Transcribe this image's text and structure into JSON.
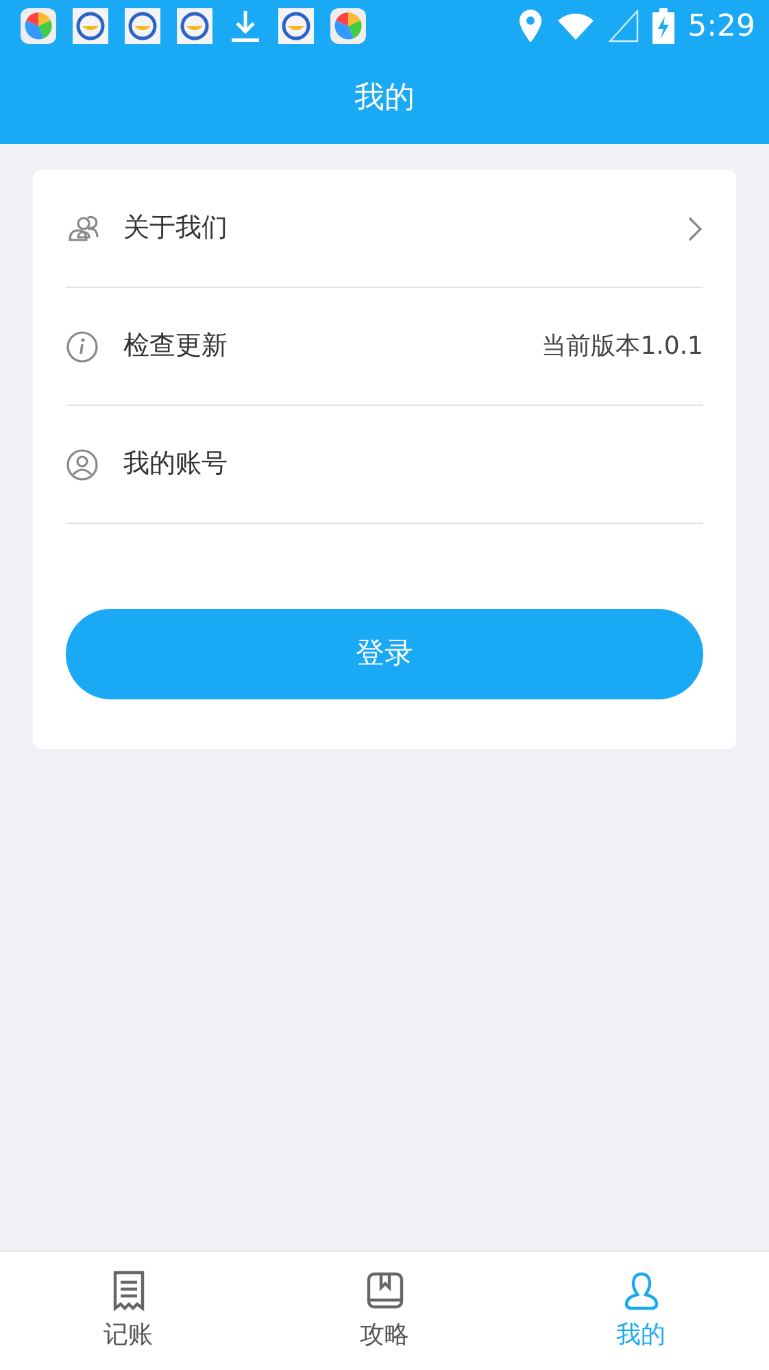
{
  "status_bar": {
    "notifications": [
      {
        "kind": "app"
      },
      {
        "kind": "chat"
      },
      {
        "kind": "chat"
      },
      {
        "kind": "chat"
      },
      {
        "kind": "download"
      },
      {
        "kind": "chat"
      },
      {
        "kind": "app"
      }
    ],
    "time": "5:29"
  },
  "header": {
    "title": "我的"
  },
  "menu": [
    {
      "kind": "about",
      "label": "关于我们",
      "chevron": true
    },
    {
      "kind": "update",
      "label": "检查更新",
      "value": "当前版本1.0.1",
      "chevron": false
    },
    {
      "kind": "account",
      "label": "我的账号",
      "chevron": false
    }
  ],
  "login_button": "登录",
  "tabs": [
    {
      "kind": "ledger",
      "label": "记账",
      "selected": false
    },
    {
      "kind": "guide",
      "label": "攻略",
      "selected": false
    },
    {
      "kind": "me",
      "label": "我的",
      "selected": true
    }
  ]
}
